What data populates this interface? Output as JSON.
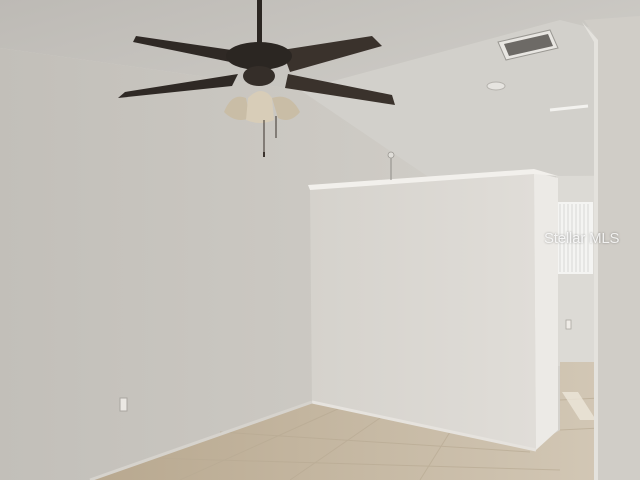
{
  "watermark": {
    "text": "Stellar MLS"
  },
  "scene": {
    "objects": [
      "ceiling-fan-icon",
      "air-vent-icon",
      "smoke-detector-icon",
      "electrical-outlet-icon",
      "window-icon",
      "half-wall",
      "tile-floor"
    ]
  },
  "colors": {
    "ceiling": "#cfcdc8",
    "wall_left": "#c9c6c0",
    "wall_center": "#dad8d3",
    "floor": "#c4b59d",
    "fan": "#2b2622",
    "window": "#f4f4f2"
  }
}
